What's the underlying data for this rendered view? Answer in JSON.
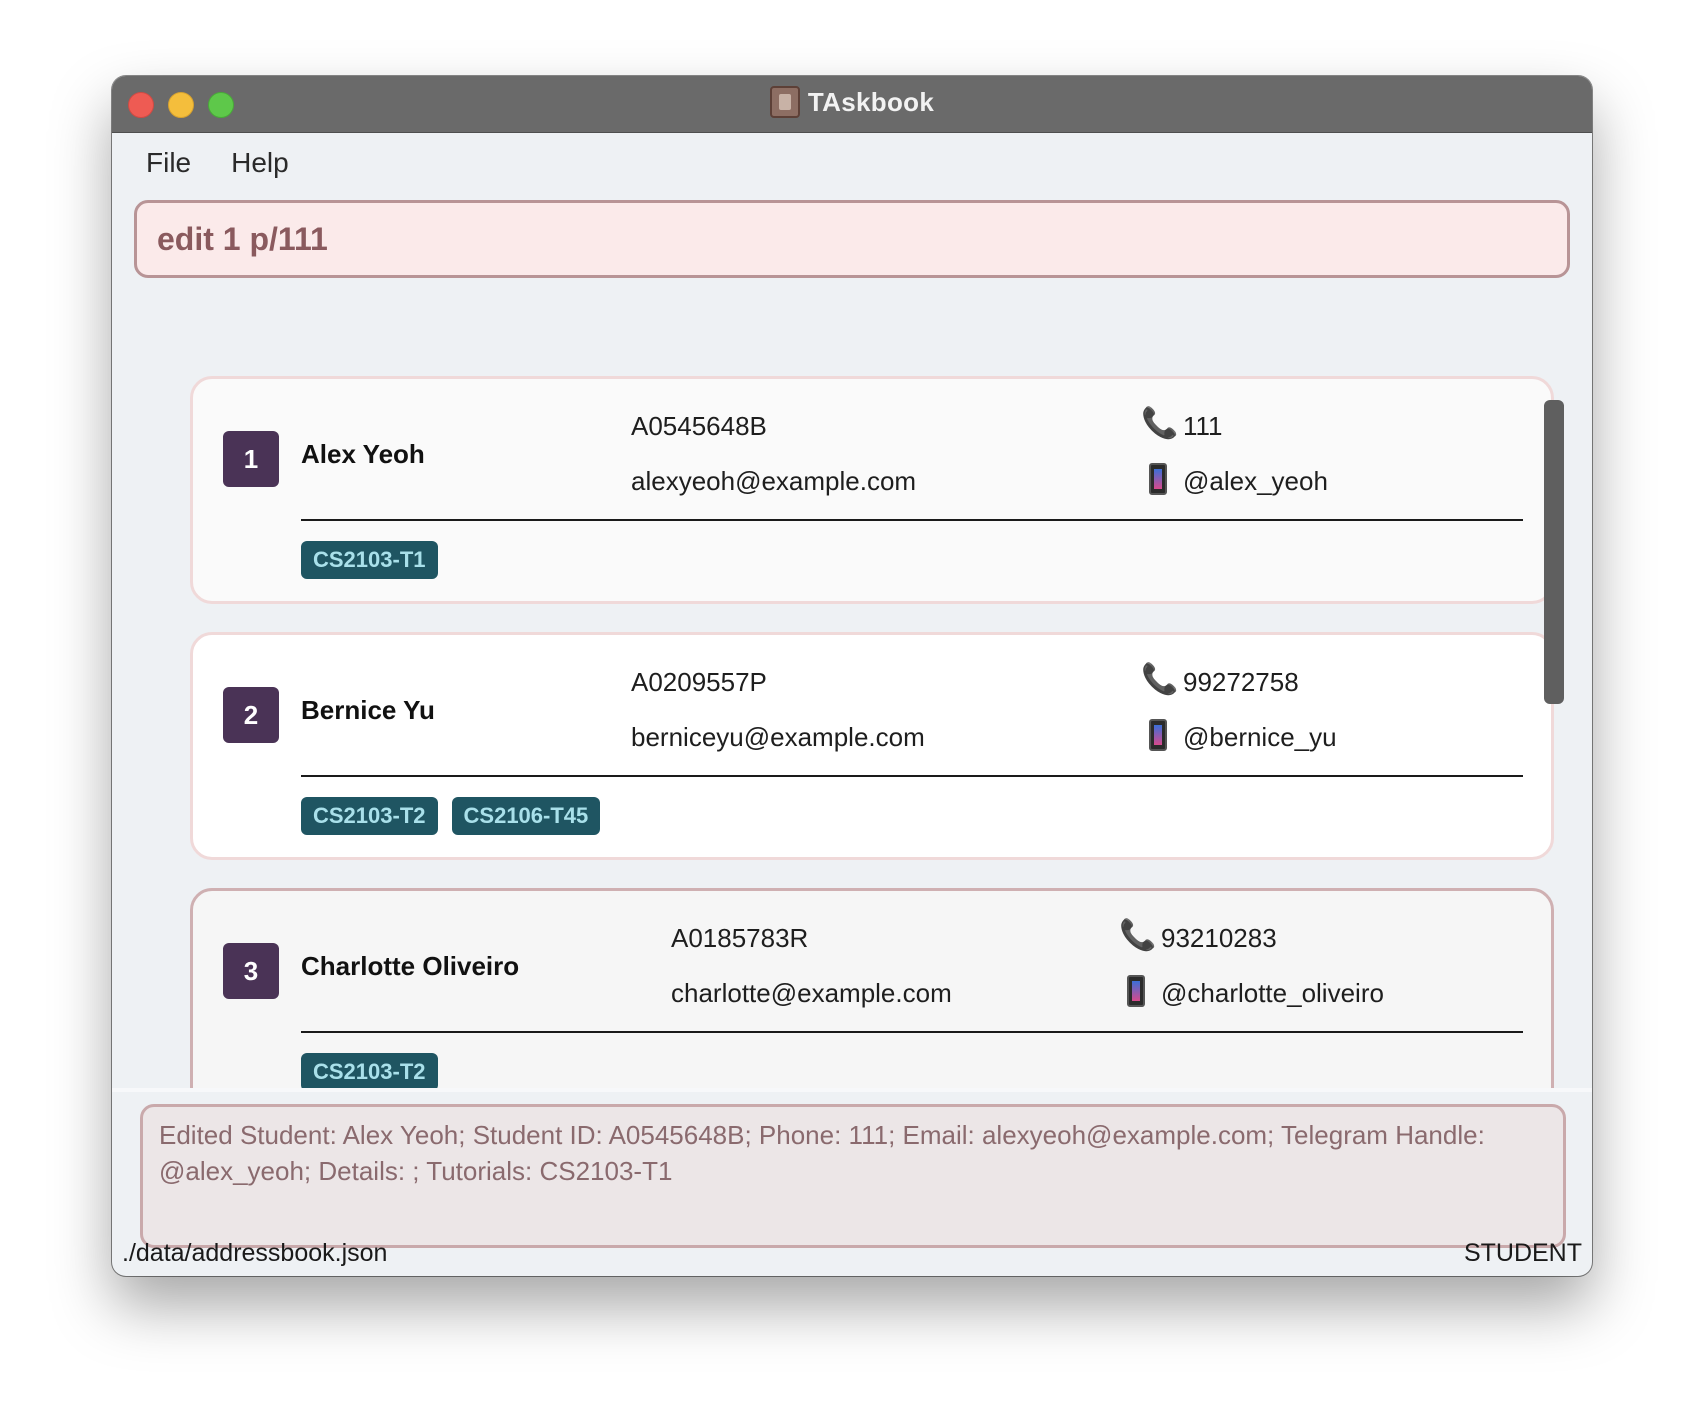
{
  "window": {
    "title": "TAskbook"
  },
  "menu": {
    "items": [
      {
        "label": "File"
      },
      {
        "label": "Help"
      }
    ]
  },
  "command_box": {
    "value": "edit 1 p/111"
  },
  "students": [
    {
      "index": "1",
      "name": "Alex Yeoh",
      "student_id": "A0545648B",
      "email": "alexyeoh@example.com",
      "phone": "111",
      "telegram": "@alex_yeoh",
      "tags": [
        "CS2103-T1"
      ]
    },
    {
      "index": "2",
      "name": "Bernice Yu",
      "student_id": "A0209557P",
      "email": "berniceyu@example.com",
      "phone": "99272758",
      "telegram": "@bernice_yu",
      "tags": [
        "CS2103-T2",
        "CS2106-T45"
      ]
    },
    {
      "index": "3",
      "name": "Charlotte Oliveiro",
      "student_id": "A0185783R",
      "email": "charlotte@example.com",
      "phone": "93210283",
      "telegram": "@charlotte_oliveiro",
      "tags": [
        "CS2103-T2"
      ]
    }
  ],
  "result": {
    "text": "Edited Student: Alex Yeoh; Student ID: A0545648B; Phone: 111; Email: alexyeoh@example.com; Telegram Handle: @alex_yeoh; Details: ; Tutorials: CS2103-T1"
  },
  "status": {
    "file_path": "./data/addressbook.json",
    "mode": "STUDENT"
  },
  "icons": {
    "phone": "phone-icon",
    "telegram": "mobile-phone-icon",
    "app": "address-book-icon"
  }
}
